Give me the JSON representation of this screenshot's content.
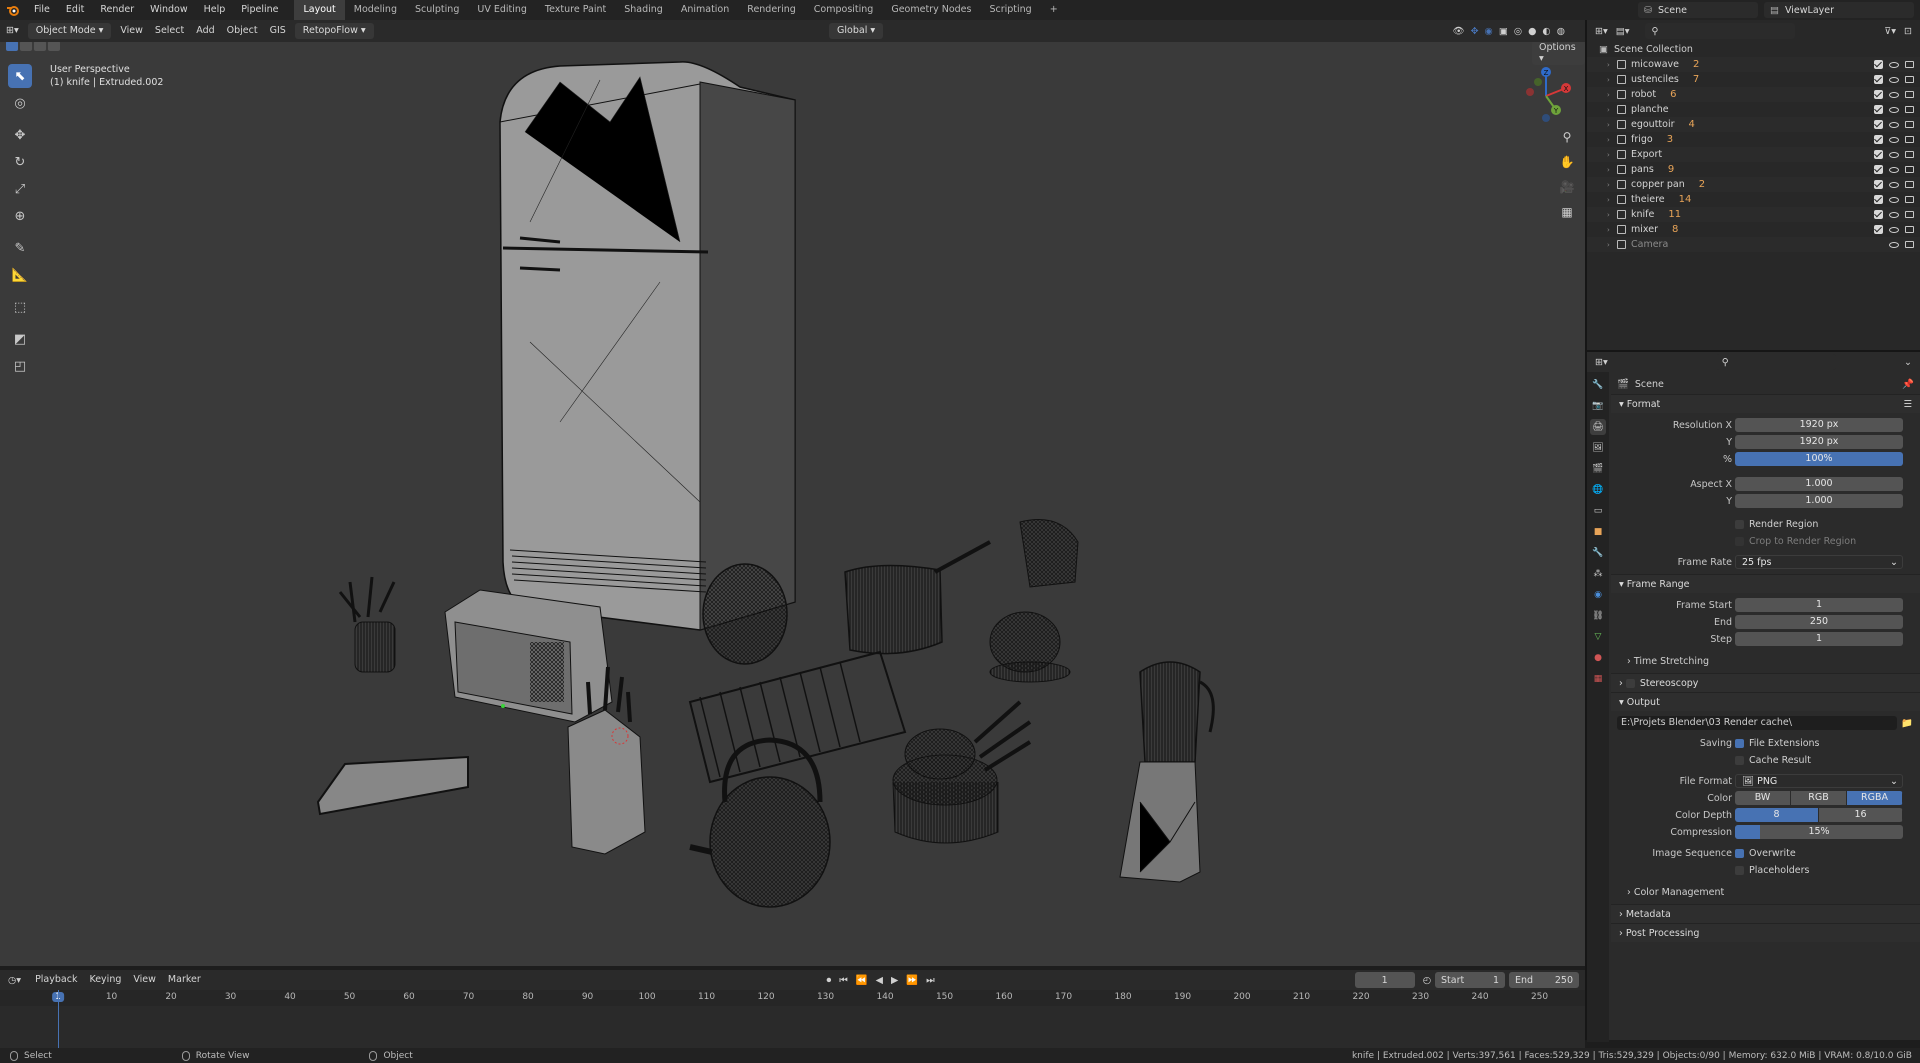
{
  "topbar": {
    "menus": [
      "File",
      "Edit",
      "Render",
      "Window",
      "Help",
      "Pipeline"
    ],
    "workspaces": [
      "Layout",
      "Modeling",
      "Sculpting",
      "UV Editing",
      "Texture Paint",
      "Shading",
      "Animation",
      "Rendering",
      "Compositing",
      "Geometry Nodes",
      "Scripting"
    ],
    "active_workspace": "Layout",
    "add_tab": "+",
    "scene": "Scene",
    "view_layer": "ViewLayer"
  },
  "viewport_header": {
    "mode": "Object Mode",
    "menus": [
      "View",
      "Select",
      "Add",
      "Object"
    ],
    "gis": "GIS",
    "addon": "RetopoFlow",
    "orientation": "Global",
    "options": "Options"
  },
  "viewport": {
    "perspective": "User Perspective",
    "active_info": "(1) knife | Extruded.002",
    "gizmo": {
      "x": "X",
      "y": "Y",
      "z": "Z"
    }
  },
  "outliner": {
    "root": "Scene Collection",
    "items": [
      {
        "name": "micowave",
        "badge": "2"
      },
      {
        "name": "ustenciles",
        "badge": "7"
      },
      {
        "name": "robot",
        "badge": "6"
      },
      {
        "name": "planche",
        "badge": ""
      },
      {
        "name": "egouttoir",
        "badge": "4"
      },
      {
        "name": "frigo",
        "badge": "3"
      },
      {
        "name": "Export",
        "badge": ""
      },
      {
        "name": "pans",
        "badge": "9"
      },
      {
        "name": "copper pan",
        "badge": "2"
      },
      {
        "name": "theiere",
        "badge": "14"
      },
      {
        "name": "knife",
        "badge": "11"
      },
      {
        "name": "mixer",
        "badge": "8"
      },
      {
        "name": "Camera",
        "badge": ""
      }
    ]
  },
  "properties": {
    "context": "Scene",
    "format": {
      "header": "Format",
      "resolution_x_label": "Resolution X",
      "resolution_x": "1920 px",
      "y_label": "Y",
      "resolution_y": "1920 px",
      "pct_label": "%",
      "resolution_pct": "100%",
      "aspect_x_label": "Aspect X",
      "aspect_x": "1.000",
      "aspect_y_label": "Y",
      "aspect_y": "1.000",
      "render_region": "Render Region",
      "crop": "Crop to Render Region",
      "frame_rate_label": "Frame Rate",
      "frame_rate": "25 fps"
    },
    "frame_range": {
      "header": "Frame Range",
      "start_label": "Frame Start",
      "start": "1",
      "end_label": "End",
      "end": "250",
      "step_label": "Step",
      "step": "1",
      "time_stretching": "Time Stretching"
    },
    "stereoscopy": "Stereoscopy",
    "output": {
      "header": "Output",
      "path": "E:\\Projets Blender\\03 Render cache\\",
      "saving_label": "Saving",
      "file_extensions": "File Extensions",
      "cache_result": "Cache Result",
      "file_format_label": "File Format",
      "file_format": "PNG",
      "color_label": "Color",
      "color_options": [
        "BW",
        "RGB",
        "RGBA"
      ],
      "color_selected": "RGBA",
      "depth_label": "Color Depth",
      "depth_options": [
        "8",
        "16"
      ],
      "depth_selected": "8",
      "compression_label": "Compression",
      "compression": "15%",
      "compression_fraction": 0.15,
      "image_sequence_label": "Image Sequence",
      "overwrite": "Overwrite",
      "placeholders": "Placeholders",
      "color_management": "Color Management"
    },
    "metadata": "Metadata",
    "post_processing": "Post Processing"
  },
  "timeline": {
    "menus": [
      "Playback",
      "Keying",
      "View",
      "Marker"
    ],
    "current_frame": "1",
    "start_label": "Start",
    "start": "1",
    "end_label": "End",
    "end": "250",
    "ticks": [
      "1",
      "10",
      "20",
      "30",
      "40",
      "50",
      "60",
      "70",
      "80",
      "90",
      "100",
      "110",
      "120",
      "130",
      "140",
      "150",
      "160",
      "170",
      "180",
      "190",
      "200",
      "210",
      "220",
      "230",
      "240",
      "250"
    ]
  },
  "statusbar": {
    "select": "Select",
    "rotate": "Rotate View",
    "object": "Object",
    "stats": "knife | Extruded.002 | Verts:397,561 | Faces:529,329 | Tris:529,329 | Objects:0/90 | Memory: 632.0 MiB | VRAM: 0.8/10.0 GiB"
  },
  "colors": {
    "accent": "#4772b3",
    "orange": "#e8a458",
    "viewport_bg": "#3a3a3a"
  }
}
